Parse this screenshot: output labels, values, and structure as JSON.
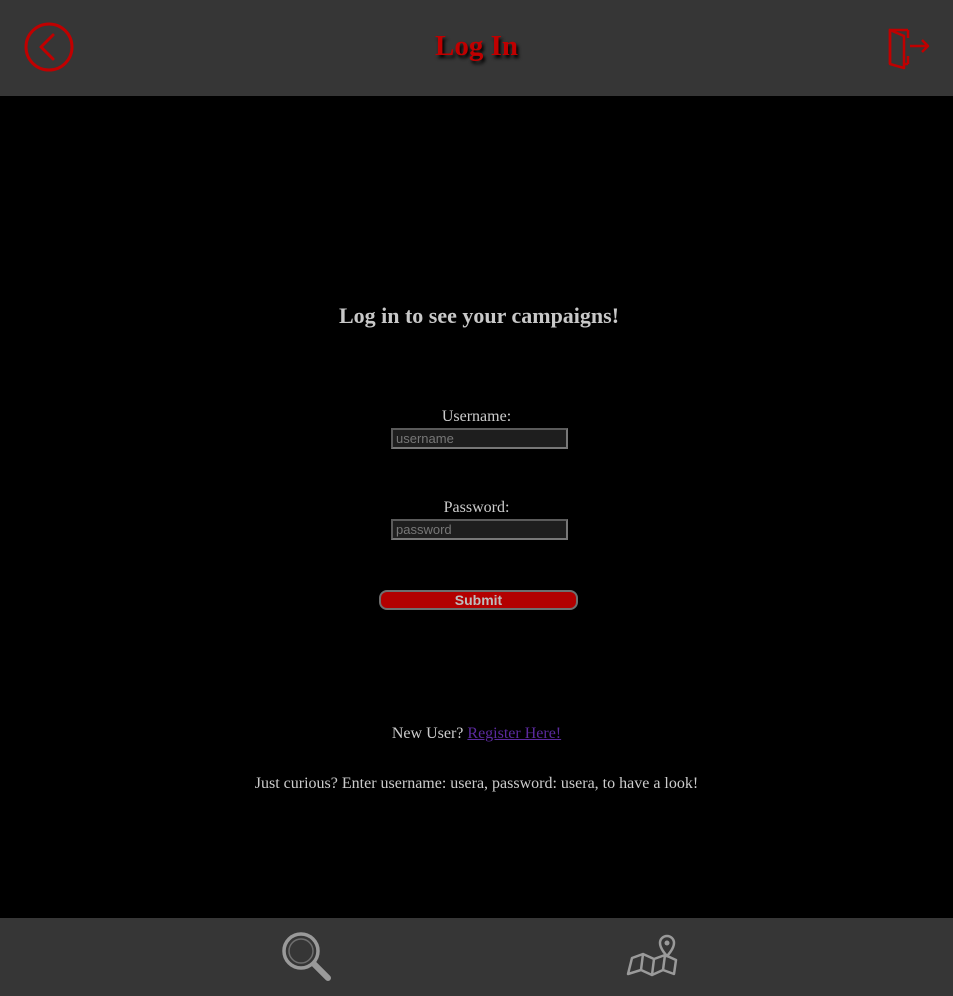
{
  "header": {
    "title": "Log In",
    "back_icon": "chevron-left-circle-icon",
    "logout_icon": "door-exit-icon",
    "accent_color": "#c00000"
  },
  "login": {
    "heading": "Log in to see your campaigns!",
    "username_label": "Username:",
    "username_placeholder": "username",
    "username_value": "",
    "password_label": "Password:",
    "password_placeholder": "password",
    "password_value": "",
    "submit_label": "Submit"
  },
  "notes": {
    "new_user_text": "New User?",
    "register_link": "Register Here!",
    "demo_hint": "Just curious? Enter username: usera, password: usera, to have a look!"
  },
  "footer": {
    "items": [
      {
        "icon": "search-icon"
      },
      {
        "icon": "map-pin-icon"
      }
    ]
  },
  "colors": {
    "bar_background": "#363636",
    "page_background": "#000000",
    "icon_gray": "#9a9a9a"
  }
}
